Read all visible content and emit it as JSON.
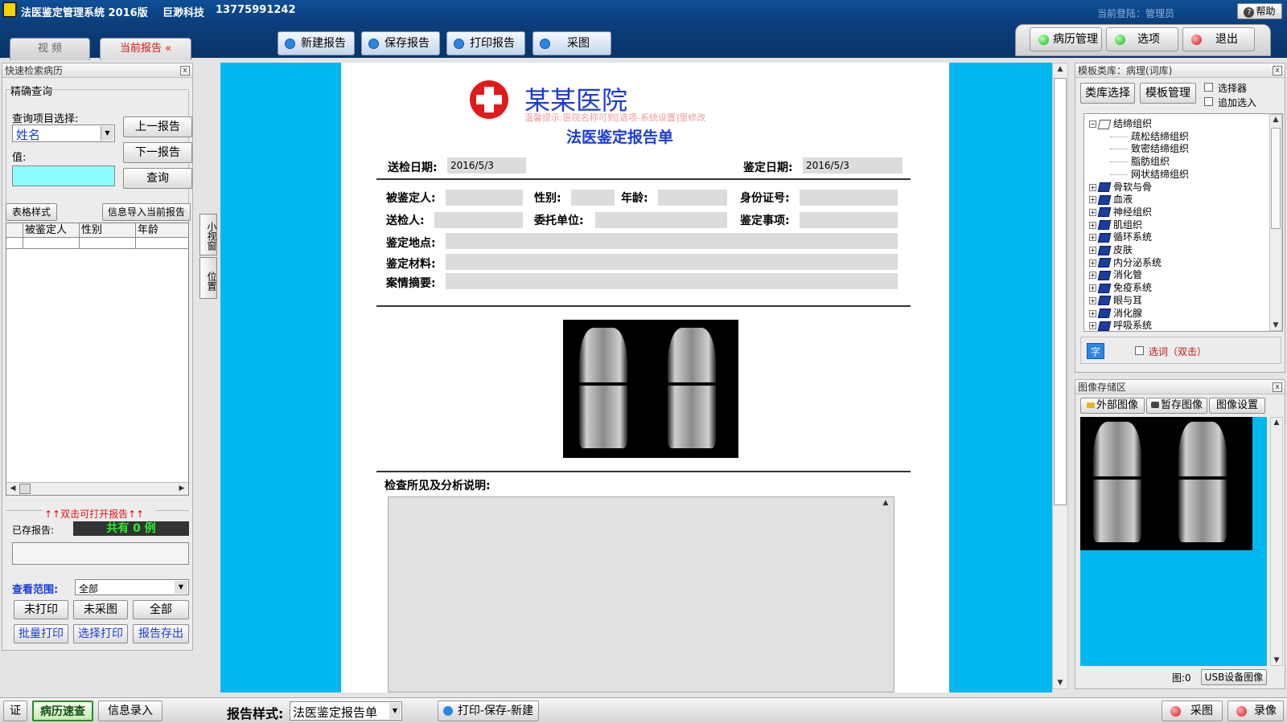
{
  "titlebar": {
    "app_title": "法医鉴定管理系统  2016版",
    "company": "巨渺科技",
    "phone": "13775991242",
    "login_text": "当前登陆：管理员",
    "help_label": "帮助"
  },
  "tabs": {
    "video": "视  频",
    "current_report": "当前报告 «"
  },
  "toolbar": {
    "new_report": "新建报告",
    "save_report": "保存报告",
    "print_report": "打印报告",
    "capture": "采图"
  },
  "right_toolbar": {
    "case_mgmt": "病历管理",
    "options": "选项",
    "exit": "退出"
  },
  "left_panel": {
    "title": "快速检索病历",
    "precise_query": "精确查询",
    "query_item_label": "查询项目选择:",
    "query_item_value": "姓名",
    "value_label": "值:",
    "prev_report": "上一报告",
    "next_report": "下一报告",
    "query_button": "查询",
    "table_style": "表格样式",
    "import_info": "信息导入当前报告",
    "columns": [
      "被鉴定人",
      "性别",
      "年龄"
    ],
    "hint": "↑↑双击可打开报告↑↑",
    "saved_label": "已存报告:",
    "saved_count": "共有  0  例",
    "range_label": "查看范围:",
    "range_value": "全部",
    "not_printed": "未打印",
    "not_captured": "未采图",
    "all": "全部",
    "batch_print": "批量打印",
    "select_print": "选择打印",
    "export_report": "报告存出"
  },
  "side_buttons": {
    "small_window": "小视窗",
    "position": "位置"
  },
  "report": {
    "hospital_name": "某某医院",
    "hint": "温馨提示:医院名称可到[选项-系统设置]里修改",
    "form_title": "法医鉴定报告单",
    "submit_date_label": "送检日期:",
    "submit_date": "2016/5/3",
    "appraisal_date_label": "鉴定日期:",
    "appraisal_date": "2016/5/3",
    "person_label": "被鉴定人:",
    "gender_label": "性别:",
    "age_label": "年龄:",
    "id_label": "身份证号:",
    "submitter_label": "送检人:",
    "entrust_label": "委托单位:",
    "matter_label": "鉴定事项:",
    "location_label": "鉴定地点:",
    "material_label": "鉴定材料:",
    "summary_label": "案情摘要:",
    "findings_label": "检查所见及分析说明:"
  },
  "template_panel": {
    "title": "模板类库：病理(词库)",
    "category_select": "类库选择",
    "template_mgmt": "模板管理",
    "selector": "选择器",
    "append_select": "追加选入",
    "tree": [
      {
        "label": "结缔组织",
        "level": 0,
        "expanded": true
      },
      {
        "label": "疏松结缔组织",
        "level": 1
      },
      {
        "label": "致密结缔组织",
        "level": 1
      },
      {
        "label": "脂肪组织",
        "level": 1
      },
      {
        "label": "网状结缔组织",
        "level": 1
      },
      {
        "label": "骨软与骨",
        "level": 0
      },
      {
        "label": "血液",
        "level": 0
      },
      {
        "label": "神经组织",
        "level": 0
      },
      {
        "label": "肌组织",
        "level": 0
      },
      {
        "label": "循环系统",
        "level": 0
      },
      {
        "label": "皮肤",
        "level": 0
      },
      {
        "label": "内分泌系统",
        "level": 0
      },
      {
        "label": "消化管",
        "level": 0
      },
      {
        "label": "免疫系统",
        "level": 0
      },
      {
        "label": "眼与耳",
        "level": 0
      },
      {
        "label": "消化腺",
        "level": 0
      },
      {
        "label": "呼吸系统",
        "level": 0
      }
    ],
    "font_button": "字",
    "select_word": "选词（双击）"
  },
  "image_panel": {
    "title": "图像存储区",
    "external_image": "外部图像",
    "temp_image": "暂存图像",
    "image_settings": "图像设置",
    "image_count": "图:0",
    "usb_image": "USB设备图像"
  },
  "bottombar": {
    "cert": "证",
    "case_quick": "病历速查",
    "info_entry": "信息录入",
    "report_style_label": "报告样式:",
    "report_style_value": "法医鉴定报告单",
    "print_save_new": "打印-保存-新建",
    "capture": "采图",
    "record": "录像"
  },
  "colors": {
    "titlebar": "#0b3f7c",
    "doc_background": "#00b7f0",
    "accent_red": "#d41212",
    "accent_blue": "#1a3cd6"
  }
}
